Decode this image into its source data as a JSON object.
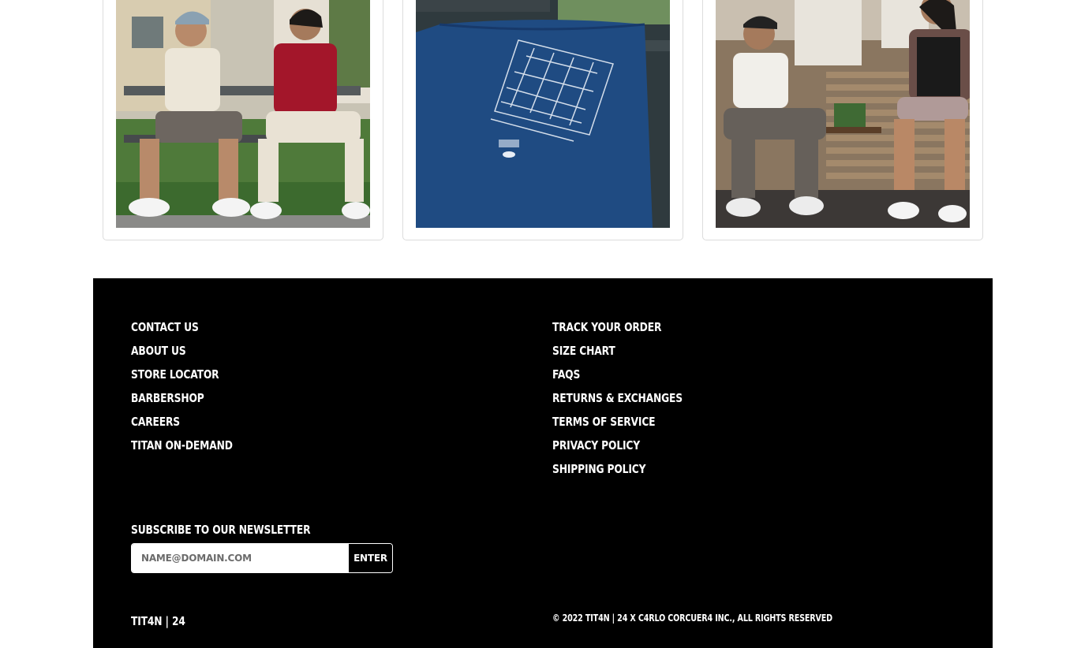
{
  "footer": {
    "left_links": [
      {
        "label": "CONTACT US"
      },
      {
        "label": "ABOUT US"
      },
      {
        "label": "STORE LOCATOR"
      },
      {
        "label": "BARBERSHOP"
      },
      {
        "label": "CAREERS"
      },
      {
        "label": "TITAN ON-DEMAND"
      }
    ],
    "right_links": [
      {
        "label": "TRACK YOUR ORDER"
      },
      {
        "label": "SIZE CHART"
      },
      {
        "label": "FAQS"
      },
      {
        "label": "RETURNS & EXCHANGES"
      },
      {
        "label": "TERMS OF SERVICE"
      },
      {
        "label": "PRIVACY POLICY"
      },
      {
        "label": "SHIPPING POLICY"
      }
    ],
    "newsletter": {
      "title": "SUBSCRIBE TO OUR NEWSLETTER",
      "placeholder": "NAME@DOMAIN.COM",
      "button_label": "ENTER"
    },
    "brand": "TIT4N | 24",
    "copyright": "© 2022 TIT4N | 24 X C4RLO CORCUER4 INC., ALL RIGHTS RESERVED"
  },
  "colors": {
    "footer_bg": "#000000",
    "footer_text": "#ffffff",
    "shirt_blue": "#1f4b82"
  }
}
